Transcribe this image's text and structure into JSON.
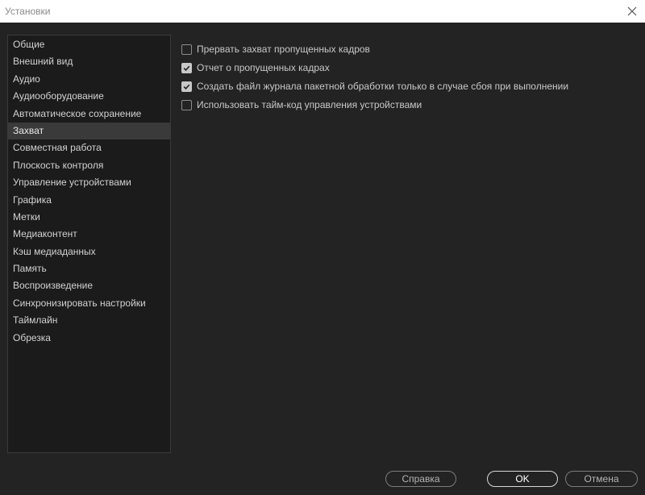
{
  "window": {
    "title": "Установки",
    "close_icon": "close-icon"
  },
  "sidebar": {
    "selected_index": 5,
    "items": [
      {
        "label": "Общие"
      },
      {
        "label": "Внешний вид"
      },
      {
        "label": "Аудио"
      },
      {
        "label": "Аудиооборудование"
      },
      {
        "label": "Автоматическое сохранение"
      },
      {
        "label": "Захват"
      },
      {
        "label": "Совместная работа"
      },
      {
        "label": "Плоскость контроля"
      },
      {
        "label": "Управление устройствами"
      },
      {
        "label": "Графика"
      },
      {
        "label": "Метки"
      },
      {
        "label": "Медиаконтент"
      },
      {
        "label": "Кэш медиаданных"
      },
      {
        "label": "Память"
      },
      {
        "label": "Воспроизведение"
      },
      {
        "label": "Синхронизировать настройки"
      },
      {
        "label": "Таймлайн"
      },
      {
        "label": "Обрезка"
      }
    ]
  },
  "capture_options": [
    {
      "label": "Прервать захват пропущенных кадров",
      "checked": false
    },
    {
      "label": "Отчет о пропущенных кадрах",
      "checked": true
    },
    {
      "label": "Создать файл журнала пакетной обработки только в случае сбоя при выполнении",
      "checked": true
    },
    {
      "label": "Использовать тайм-код управления устройствами",
      "checked": false
    }
  ],
  "buttons": {
    "help_label": "Справка",
    "ok_label": "OK",
    "cancel_label": "Отмена"
  },
  "colors": {
    "background": "#232323",
    "sidebar_background": "#1b1b1b",
    "selected_item": "#3a3a3a",
    "text": "#c8c8c8"
  }
}
